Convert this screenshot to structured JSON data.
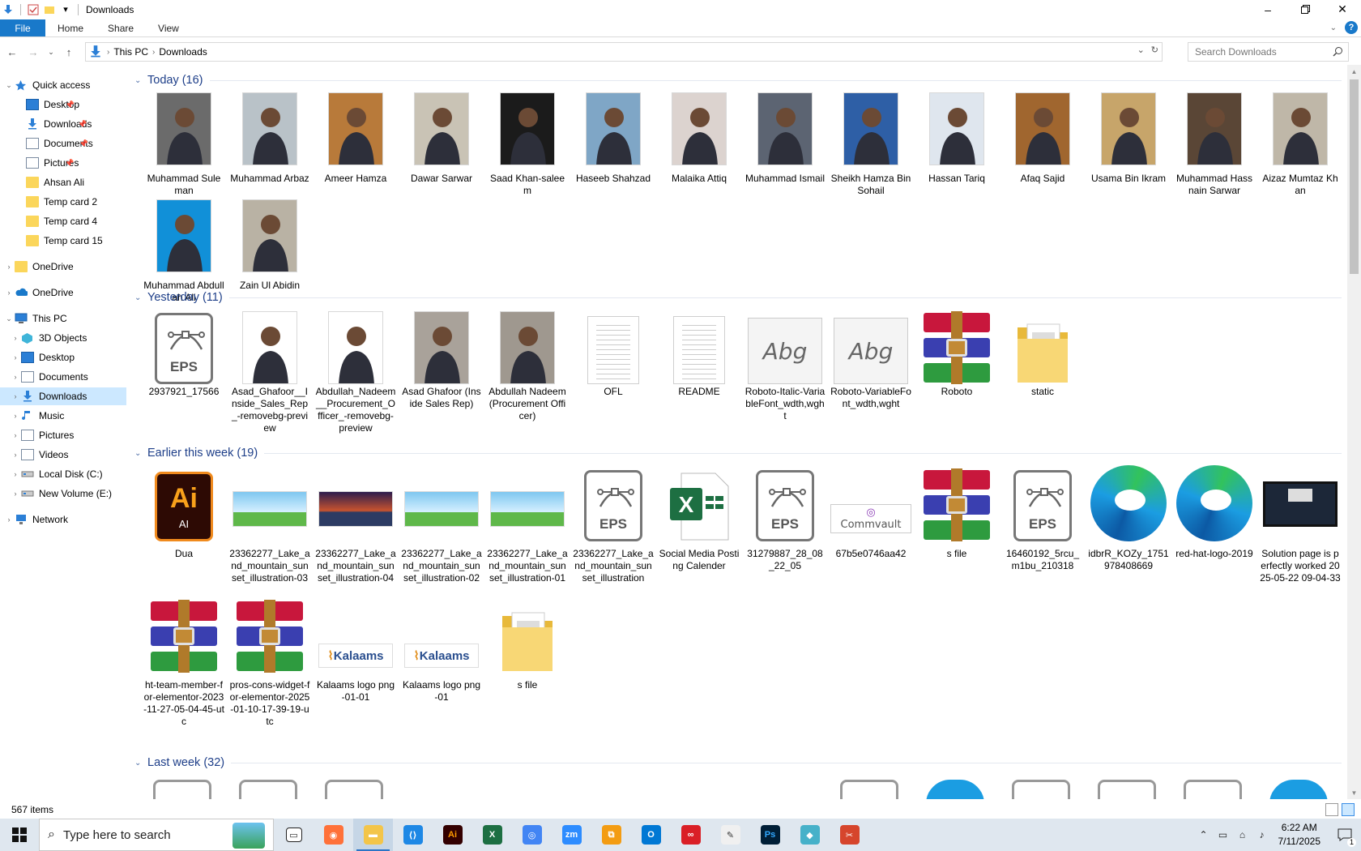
{
  "window": {
    "title": "Downloads"
  },
  "ribbon": {
    "tabs": [
      "File",
      "Home",
      "Share",
      "View"
    ],
    "help": "?"
  },
  "address": {
    "crumbs": [
      "This PC",
      "Downloads"
    ]
  },
  "search": {
    "placeholder": "Search Downloads"
  },
  "nav": {
    "quick_access": "Quick access",
    "qa_items": [
      {
        "label": "Desktop",
        "icon": "desktop-icon",
        "pinned": true
      },
      {
        "label": "Downloads",
        "icon": "downloads-icon",
        "pinned": true
      },
      {
        "label": "Documents",
        "icon": "documents-icon",
        "pinned": true
      },
      {
        "label": "Pictures",
        "icon": "pictures-icon",
        "pinned": true
      },
      {
        "label": "Ahsan Ali",
        "icon": "folder-icon",
        "pinned": false
      },
      {
        "label": "Temp  card 2",
        "icon": "folder-icon",
        "pinned": false
      },
      {
        "label": "Temp  card 4",
        "icon": "folder-icon",
        "pinned": false
      },
      {
        "label": "Temp  card 15",
        "icon": "folder-icon",
        "pinned": false
      }
    ],
    "onedrive1": "OneDrive",
    "onedrive2": "OneDrive",
    "this_pc": "This PC",
    "pc_items": [
      {
        "label": "3D Objects",
        "icon": "3d-objects-icon"
      },
      {
        "label": "Desktop",
        "icon": "desktop-icon"
      },
      {
        "label": "Documents",
        "icon": "documents-icon"
      },
      {
        "label": "Downloads",
        "icon": "downloads-icon",
        "selected": true
      },
      {
        "label": "Music",
        "icon": "music-icon"
      },
      {
        "label": "Pictures",
        "icon": "pictures-icon"
      },
      {
        "label": "Videos",
        "icon": "videos-icon"
      },
      {
        "label": "Local Disk (C:)",
        "icon": "drive-icon"
      },
      {
        "label": "New Volume (E:)",
        "icon": "drive-icon"
      }
    ],
    "network": "Network"
  },
  "groups": {
    "today": {
      "title": "Today (16)",
      "items": [
        {
          "name": "Muhammad Suleman",
          "bg": "#6b6b6b"
        },
        {
          "name": "Muhammad Arbaz",
          "bg": "#b9c2c8"
        },
        {
          "name": "Ameer Hamza",
          "bg": "#b87a3a"
        },
        {
          "name": "Dawar Sarwar",
          "bg": "#c9c3b5"
        },
        {
          "name": "Saad Khan-saleem",
          "bg": "#1b1b1b"
        },
        {
          "name": "Haseeb Shahzad",
          "bg": "#7fa6c6"
        },
        {
          "name": "Malaika Attiq",
          "bg": "#dcd3cf"
        },
        {
          "name": "Muhammad Ismail",
          "bg": "#5c6472"
        },
        {
          "name": "Sheikh Hamza Bin Sohail",
          "bg": "#2e5fa6"
        },
        {
          "name": "Hassan Tariq",
          "bg": "#dfe6ee"
        },
        {
          "name": "Afaq Sajid",
          "bg": "#a0662f"
        },
        {
          "name": "Usama Bin Ikram",
          "bg": "#c7a56a"
        },
        {
          "name": "Muhammad Hassnain Sarwar",
          "bg": "#5a4636"
        },
        {
          "name": "Aizaz Mumtaz Khan",
          "bg": "#bfb7a8"
        },
        {
          "name": "Muhammad Abdullah Ali",
          "bg": "#1190d8"
        },
        {
          "name": "Zain Ul Abidin",
          "bg": "#b9b2a4"
        }
      ]
    },
    "yesterday": {
      "title": "Yesterday (11)",
      "items": [
        {
          "name": "2937921_17566",
          "kind": "eps"
        },
        {
          "name": "Asad_Ghafoor__Inside_Sales_Rep_-removebg-preview",
          "kind": "photo",
          "bg": "#ffffff"
        },
        {
          "name": "Abdullah_Nadeem__Procurement_Officer_-removebg-preview",
          "kind": "photo",
          "bg": "#ffffff"
        },
        {
          "name": "Asad Ghafoor (Inside Sales Rep)",
          "kind": "photo",
          "bg": "#a9a29a"
        },
        {
          "name": "Abdullah Nadeem (Procurement Officer)",
          "kind": "photo",
          "bg": "#9f988f"
        },
        {
          "name": "OFL",
          "kind": "txt"
        },
        {
          "name": "README",
          "kind": "txt"
        },
        {
          "name": "Roboto-Italic-VariableFont_wdth,wght",
          "kind": "font",
          "glyph": "Abg"
        },
        {
          "name": "Roboto-VariableFont_wdth,wght",
          "kind": "font",
          "glyph": "Abg"
        },
        {
          "name": "Roboto",
          "kind": "rar"
        },
        {
          "name": "static",
          "kind": "folder"
        }
      ]
    },
    "earlier": {
      "title": "Earlier this week (19)",
      "items": [
        {
          "name": "Dua",
          "kind": "ai"
        },
        {
          "name": "23362277_Lake_and_mountain_sunset_illustration-03",
          "kind": "scene"
        },
        {
          "name": "23362277_Lake_and_mountain_sunset_illustration-04",
          "kind": "scene-dark"
        },
        {
          "name": "23362277_Lake_and_mountain_sunset_illustration-02",
          "kind": "scene"
        },
        {
          "name": "23362277_Lake_and_mountain_sunset_illustration-01",
          "kind": "scene"
        },
        {
          "name": "23362277_Lake_and_mountain_sunset_illustration",
          "kind": "eps"
        },
        {
          "name": "Social Media Posting Calender",
          "kind": "xls"
        },
        {
          "name": "31279887_28_08_22_05",
          "kind": "eps"
        },
        {
          "name": "67b5e0746aa42",
          "kind": "commvault"
        },
        {
          "name": "s file",
          "kind": "rar"
        },
        {
          "name": "16460192_5rcu_m1bu_210318",
          "kind": "eps"
        },
        {
          "name": "idbrR_KOZy_1751978408669",
          "kind": "edge"
        },
        {
          "name": "red-hat-logo-2019",
          "kind": "edge"
        },
        {
          "name": "Solution page is perfectly worked 2025-05-22 09-04-33",
          "kind": "video"
        },
        {
          "name": "ht-team-member-for-elementor-2023-11-27-05-04-45-utc",
          "kind": "rar"
        },
        {
          "name": "pros-cons-widget-for-elementor-2025-01-10-17-39-19-utc",
          "kind": "rar"
        },
        {
          "name": "Kalaams logo png-01-01",
          "kind": "kalaams"
        },
        {
          "name": "Kalaams logo png-01",
          "kind": "kalaams"
        },
        {
          "name": "s file",
          "kind": "folder"
        }
      ]
    },
    "lastweek": {
      "title": "Last week (32)"
    }
  },
  "labels": {
    "eps": "EPS",
    "ai_big": "Ai",
    "ai_small": "AI",
    "commvault": "Commvault",
    "kalaams": "Kalaams"
  },
  "status": {
    "items": "567 items"
  },
  "taskbar": {
    "search_placeholder": "Type here to search",
    "apps": [
      "task-view",
      "firefox",
      "file-explorer",
      "vscode",
      "illustrator",
      "excel",
      "chrome",
      "zoom",
      "bracket-app",
      "outlook",
      "creative-cloud",
      "pen-tool",
      "photoshop",
      "app-diamond",
      "app-scissors"
    ],
    "time": "6:22 AM",
    "date": "7/11/2025",
    "notif_count": "1"
  },
  "colors": {
    "accent": "#1979ca",
    "selected": "#cce8ff",
    "group_header": "#1e3f89"
  }
}
